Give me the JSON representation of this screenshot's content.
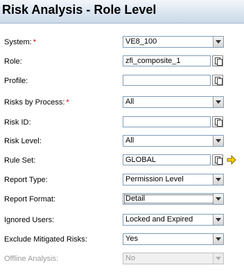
{
  "page": {
    "title": "Risk Analysis - Role Level"
  },
  "fields": {
    "system": {
      "label": "System:",
      "required_mark": "*",
      "value": "VE8_100"
    },
    "role": {
      "label": "Role:",
      "value": "zfi_composite_1"
    },
    "profile": {
      "label": "Profile:",
      "value": ""
    },
    "risks_by_process": {
      "label": "Risks by Process:",
      "required_mark": "*",
      "value": "All"
    },
    "risk_id": {
      "label": "Risk ID:",
      "value": ""
    },
    "risk_level": {
      "label": "Risk Level:",
      "value": "All"
    },
    "rule_set": {
      "label": "Rule Set:",
      "value": "GLOBAL"
    },
    "report_type": {
      "label": "Report Type:",
      "value": "Permission Level"
    },
    "report_format": {
      "label": "Report Format:",
      "value": "Detail"
    },
    "ignored_users": {
      "label": "Ignored Users:",
      "value": "Locked and Expired"
    },
    "exclude_mitigated_risks": {
      "label": "Exclude Mitigated Risks:",
      "value": "Yes"
    },
    "offline_analysis": {
      "label": "Offline Analysis:",
      "value": "No",
      "disabled": true
    }
  },
  "icons": {
    "dropdown": "chevron-down-icon",
    "lookup": "value-help-icon",
    "navigate": "arrow-right-icon"
  },
  "colors": {
    "title_bar": "#dfe8f2",
    "required": "#cc0000",
    "field_border": "#7f9db9",
    "disabled_text": "#9a9a9a",
    "nav_arrow": "#f5d000"
  }
}
